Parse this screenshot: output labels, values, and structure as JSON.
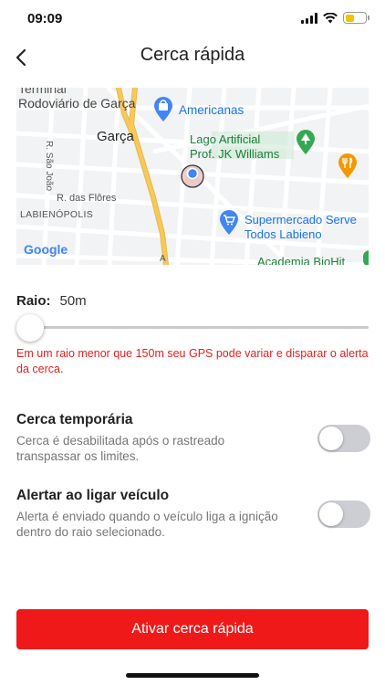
{
  "status_bar": {
    "time": "09:09",
    "battery_level": 0.45,
    "battery_color": "#f5c400"
  },
  "header": {
    "title": "Cerca rápida",
    "back_icon": "chevron-left-icon"
  },
  "map": {
    "labels": {
      "terminal": "Terminal",
      "rodoviario": "Rodoviário de Garça",
      "garca": "Garça",
      "americanas": "Americanas",
      "lago1": "Lago Artificial",
      "lago2": "Prof. JK Williams",
      "rua_sao_joao": "R. São João",
      "rua_das_flores": "R. das Flôres",
      "labienopolis": "LABIENÓPOLIS",
      "supermercado1": "Supermercado Serve",
      "supermercado2": "Todos Labieno",
      "academia": "Academia BioHit",
      "google": "Google",
      "road_marker": "A"
    },
    "poi_icons": [
      "shopping-bag-icon",
      "park-pin-icon",
      "restaurant-icon",
      "cart-icon",
      "location-marker-icon"
    ],
    "colors": {
      "background": "#f1f3f4",
      "road": "#ffffff",
      "highway": "#f7c85a",
      "pin_blue": "#4285f4",
      "pin_green": "#34a853",
      "pin_orange": "#f29900"
    }
  },
  "radius": {
    "label": "Raio:",
    "value": "50m",
    "slider_fraction": 0.0
  },
  "warning": "Em um raio menor que 150m seu GPS pode variar e disparar o alerta da cerca.",
  "options": [
    {
      "title": "Cerca temporária",
      "description": "Cerca é desabilitada após o rastreado transpassar os limites.",
      "enabled": false
    },
    {
      "title": "Alertar ao ligar veículo",
      "description": "Alerta é enviado quando o veículo liga a ignição dentro do raio selecionado.",
      "enabled": false
    }
  ],
  "activate_button": {
    "label": "Ativar cerca rápida",
    "color": "#f01919"
  },
  "accent_color": "#e52020"
}
